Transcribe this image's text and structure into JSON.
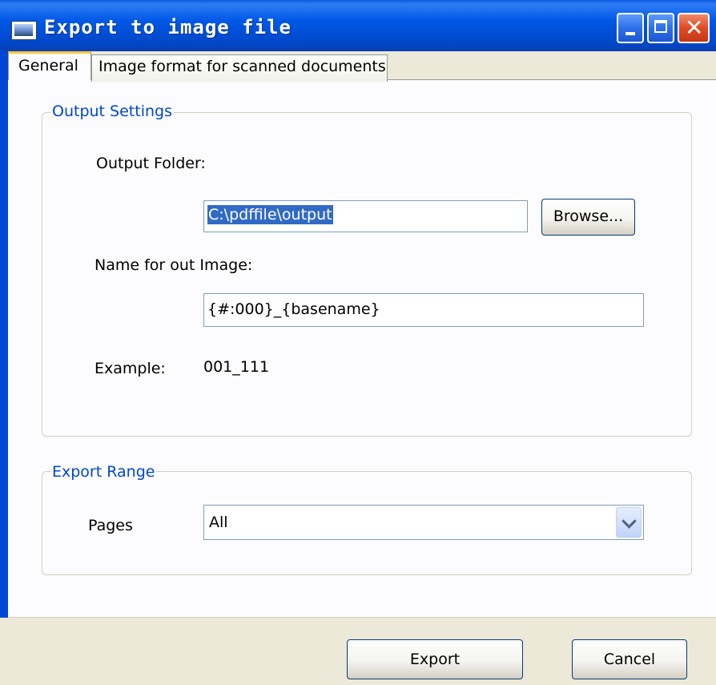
{
  "window": {
    "title": "Export to image file"
  },
  "tabs": [
    {
      "label": "General",
      "active": true
    },
    {
      "label": "Image format for scanned documents",
      "active": false
    }
  ],
  "output_settings": {
    "legend": "Output Settings",
    "folder_label": "Output Folder:",
    "folder_value": "C:\\pdffile\\output",
    "browse_label": "Browse...",
    "name_label": "Name for out Image:",
    "name_value": "{#:000}_{basename}",
    "example_label": "Example:",
    "example_value": "001_111"
  },
  "export_range": {
    "legend": "Export Range",
    "pages_label": "Pages",
    "pages_value": "All"
  },
  "footer": {
    "export_label": "Export",
    "cancel_label": "Cancel"
  },
  "colors": {
    "titlebar": "#0058e6",
    "legend_text": "#0046d5",
    "selection": "#316ac5",
    "close_button": "#e04a23"
  }
}
